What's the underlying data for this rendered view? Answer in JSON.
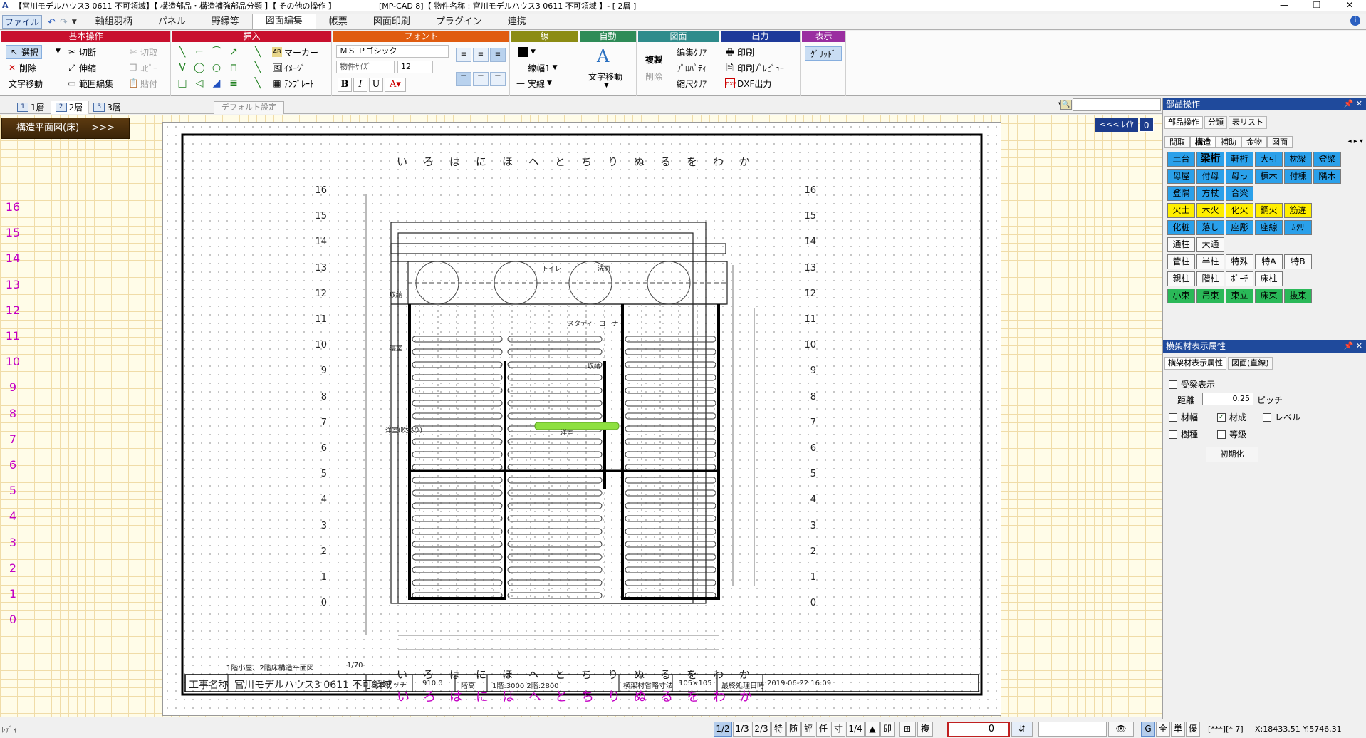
{
  "titlebar": {
    "title": "【宮川モデルハウス3 0611 不可領域】【 構造部品・構造補強部品分類 】【 その他の操作 】",
    "app_title": "[MP-CAD 8]【 物件名称 : 宮川モデルハウス3 0611 不可領域 】- [ 2層 ]"
  },
  "menu": {
    "file": "ファイル",
    "tabs": [
      {
        "label": "軸組羽柄"
      },
      {
        "label": "パネル"
      },
      {
        "label": "野縁等"
      },
      {
        "label": "図面編集"
      },
      {
        "label": "帳票"
      },
      {
        "label": "図面印刷"
      },
      {
        "label": "プラグイン"
      },
      {
        "label": "連携"
      }
    ]
  },
  "ribbon": {
    "basic": {
      "header": "基本操作",
      "select": "選択",
      "cut": "切断",
      "cut2": "切取",
      "delete": "削除",
      "stretch": "伸縮",
      "copy": "ｺﾋﾟｰ",
      "text_move": "文字移動",
      "range_edit": "範囲編集",
      "paste": "貼付"
    },
    "insert": {
      "header": "挿入",
      "marker": "マーカー",
      "image": "ｲﾒｰｼﾞ",
      "template": "ﾃﾝﾌﾟﾚｰﾄ"
    },
    "font": {
      "header": "フォント",
      "family": "ＭＳ Ｐゴシック",
      "size_label": "物件ｻｲｽﾞ",
      "size": "12"
    },
    "line": {
      "header": "線",
      "width": "線幅1",
      "style": "実線"
    },
    "auto": {
      "header": "自動",
      "text_move": "文字移動"
    },
    "drawing": {
      "header": "図面",
      "duplicate": "複製",
      "delete": "削除",
      "edit_clear": "編集ｸﾘｱ",
      "property": "ﾌﾟﾛﾊﾟﾃｨ",
      "scale_clear": "縮尺ｸﾘｱ"
    },
    "output": {
      "header": "出力",
      "print": "印刷",
      "print_preview": "印刷ﾌﾟﾚﾋﾞｭｰ",
      "dxf": "DXF出力"
    },
    "display": {
      "header": "表示",
      "grid": "ｸﾞﾘｯﾄﾞ"
    }
  },
  "page_tabs": [
    {
      "label": "1層",
      "icon": "1"
    },
    {
      "label": "2層",
      "icon": "2"
    },
    {
      "label": "3層",
      "icon": "3"
    }
  ],
  "default_tab": "デフォルト設定",
  "canvas": {
    "view_badge": "構造平面図(床)　 >>>",
    "layer_button": "<<< ﾚｲﾔ",
    "layer_num": "0",
    "row_numbers": [
      "16",
      "15",
      "14",
      "13",
      "12",
      "11",
      "10",
      "9",
      "8",
      "7",
      "6",
      "5",
      "4",
      "3",
      "2",
      "1",
      "0"
    ],
    "kana_row": [
      "い",
      "ろ",
      "は",
      "に",
      "ほ",
      "へ",
      "と",
      "ち",
      "り",
      "ぬ",
      "る",
      "を",
      "わ",
      "か"
    ],
    "drawing_caption": "1階小屋、2階床構造平面図",
    "drawing_scale": "1/70",
    "rooms": {
      "toilet": "トイレ",
      "washroom": "洗面",
      "storage": "収納",
      "bedroom": "寝室",
      "study": "スタディーコーナー",
      "storage2": "収納",
      "bedroom_upper": "洋室(吹抜り)",
      "western": "洋室"
    },
    "title_block": {
      "label_project": "工事名称",
      "project": "宮川モデルハウス3 0611 不可領域",
      "label_pitch": "基本ピッチ",
      "pitch": "910.0",
      "label_height": "階高",
      "height": "1階:3000 2階:2800",
      "label_timber": "横架材省略寸法",
      "timber": "105×105",
      "label_last": "最終処理日時",
      "last": "2019-06-22 16:09"
    }
  },
  "parts_panel": {
    "title": "部品操作",
    "subtabs": [
      "部品操作",
      "分類",
      "表リスト"
    ],
    "categories": [
      "間取",
      "構造",
      "補助",
      "金物",
      "図面"
    ],
    "rows": [
      [
        {
          "l": "土台",
          "c": "blue"
        },
        {
          "l": "梁桁",
          "c": "blue",
          "b": true
        },
        {
          "l": "軒桁",
          "c": "blue"
        },
        {
          "l": "大引",
          "c": "blue"
        },
        {
          "l": "枕梁",
          "c": "blue"
        },
        {
          "l": "登梁",
          "c": "blue"
        }
      ],
      [
        {
          "l": "母屋",
          "c": "blue"
        },
        {
          "l": "付母",
          "c": "blue"
        },
        {
          "l": "母っ",
          "c": "blue"
        },
        {
          "l": "棟木",
          "c": "blue"
        },
        {
          "l": "付棟",
          "c": "blue"
        },
        {
          "l": "隅木",
          "c": "blue"
        }
      ],
      [
        {
          "l": "登隅",
          "c": "blue"
        },
        {
          "l": "方杖",
          "c": "blue"
        },
        {
          "l": "合梁",
          "c": "blue"
        }
      ],
      [
        {
          "l": "火土",
          "c": "yel"
        },
        {
          "l": "木火",
          "c": "yel"
        },
        {
          "l": "化火",
          "c": "yel"
        },
        {
          "l": "鋼火",
          "c": "yel"
        },
        {
          "l": "筋違",
          "c": "yel"
        }
      ],
      [
        {
          "l": "化粧",
          "c": "blue"
        },
        {
          "l": "落し",
          "c": "blue"
        },
        {
          "l": "座彫",
          "c": "blue"
        },
        {
          "l": "座線",
          "c": "blue"
        },
        {
          "l": "ﾑｸﾘ",
          "c": "blue"
        }
      ],
      [
        {
          "l": "通柱",
          "c": "wht"
        },
        {
          "l": "大通",
          "c": "wht"
        }
      ],
      [
        {
          "l": "管柱",
          "c": "wht"
        },
        {
          "l": "半柱",
          "c": "wht"
        },
        {
          "l": "特殊",
          "c": "wht"
        },
        {
          "l": "特A",
          "c": "wht"
        },
        {
          "l": "特B",
          "c": "wht"
        }
      ],
      [
        {
          "l": "親柱",
          "c": "wht"
        },
        {
          "l": "階柱",
          "c": "wht"
        },
        {
          "l": "ﾎﾟｰﾁ",
          "c": "wht"
        },
        {
          "l": "床柱",
          "c": "wht"
        }
      ],
      [
        {
          "l": "小束",
          "c": "grn"
        },
        {
          "l": "吊束",
          "c": "grn"
        },
        {
          "l": "束立",
          "c": "grn"
        },
        {
          "l": "床束",
          "c": "grn"
        },
        {
          "l": "抜束",
          "c": "grn"
        }
      ]
    ]
  },
  "attr_panel": {
    "title": "横架材表示属性",
    "subtabs": [
      "横架材表示属性",
      "図面(直線)"
    ],
    "receive_beam": "受梁表示",
    "distance_label": "距離",
    "distance": "0.25",
    "pitch_unit": "ピッチ",
    "width": "材幅",
    "composition": "材成",
    "level": "レベル",
    "species": "樹種",
    "grade": "等級",
    "init": "初期化"
  },
  "statusbar": {
    "left": "ﾚﾃﾞｨ",
    "buttons": [
      "1/2",
      "1/3",
      "2/3",
      "特",
      "随",
      "評",
      "任",
      "寸",
      "1/4",
      "▲",
      "即"
    ],
    "copy": "複",
    "value": "0",
    "right_buttons": [
      "G",
      "全",
      "単",
      "優"
    ],
    "mode": "[***][* 7]",
    "coords": "X:18433.51 Y:5746.31"
  },
  "colors": {
    "ribbon_basic": "#c8102e",
    "ribbon_insert": "#c8102e",
    "ribbon_font": "#e05c10",
    "ribbon_line": "#8c8c14",
    "ribbon_auto": "#2e8b57",
    "ribbon_drawing": "#2e8b8b",
    "ribbon_output": "#1e3a9a",
    "ribbon_display": "#9a2ea0",
    "highlight_beam": "#8ee040",
    "row_number": "#c400c4"
  }
}
